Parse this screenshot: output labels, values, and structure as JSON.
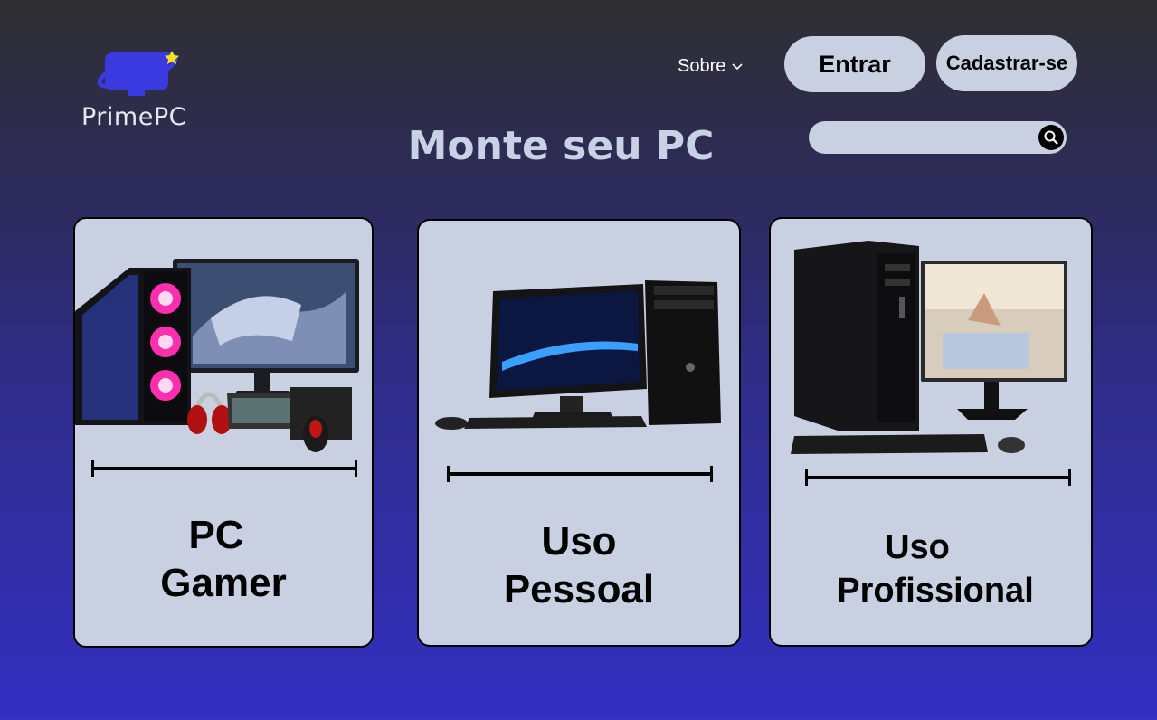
{
  "brand": {
    "name": "PrimePC",
    "icon": "monitor-planet-logo",
    "accent": "#3a3ae0",
    "star_color": "#f7e11a"
  },
  "nav": {
    "about_label": "Sobre",
    "about_icon": "chevron-down-icon"
  },
  "auth": {
    "login_label": "Entrar",
    "signup_label": "Cadastrar-se"
  },
  "search": {
    "placeholder": "",
    "icon": "search-icon"
  },
  "page": {
    "title": "Monte seu PC"
  },
  "cards": [
    {
      "line1": "PC",
      "line2": "Gamer",
      "image": "gaming-pc-setup"
    },
    {
      "line1": "Uso",
      "line2": "Pessoal",
      "image": "hp-desktop-setup"
    },
    {
      "line1": "Uso",
      "line2": "Profissional",
      "image": "office-desktop-setup"
    }
  ],
  "colors": {
    "card_bg": "#c8d0e2",
    "button_bg": "#c8d0e2",
    "title": "#c9d1e6"
  }
}
